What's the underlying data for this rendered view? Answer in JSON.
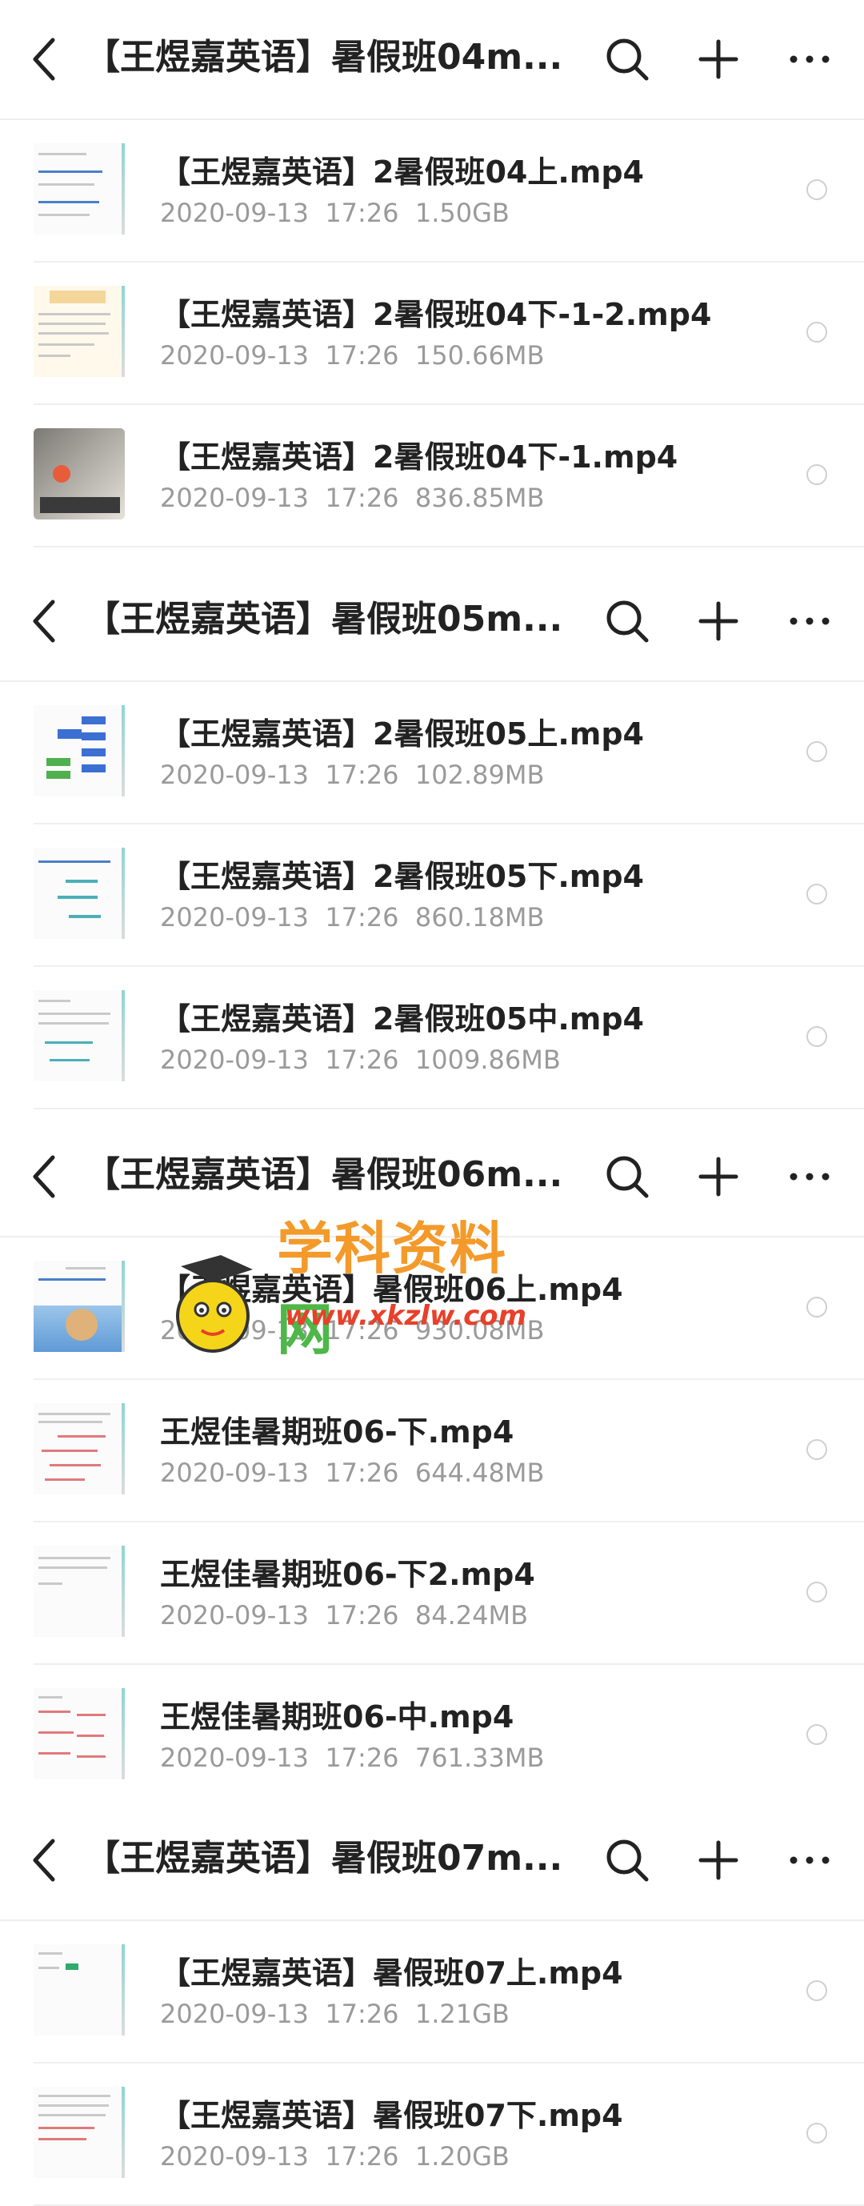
{
  "icons": {
    "back": "chevron-left-icon",
    "search": "search-icon",
    "add": "plus-icon",
    "more": "more-dots-icon"
  },
  "sections": [
    {
      "title": "【王煜嘉英语】暑假班04m...",
      "files": [
        {
          "name": "【王煜嘉英语】2暑假班04上.mp4",
          "meta": "2020-09-13  17:26  1.50GB"
        },
        {
          "name": "【王煜嘉英语】2暑假班04下-1-2.mp4",
          "meta": "2020-09-13  17:26  150.66MB"
        },
        {
          "name": "【王煜嘉英语】2暑假班04下-1.mp4",
          "meta": "2020-09-13  17:26  836.85MB"
        }
      ]
    },
    {
      "title": "【王煜嘉英语】暑假班05m...",
      "files": [
        {
          "name": "【王煜嘉英语】2暑假班05上.mp4",
          "meta": "2020-09-13  17:26  102.89MB"
        },
        {
          "name": "【王煜嘉英语】2暑假班05下.mp4",
          "meta": "2020-09-13  17:26  860.18MB"
        },
        {
          "name": "【王煜嘉英语】2暑假班05中.mp4",
          "meta": "2020-09-13  17:26  1009.86MB"
        }
      ]
    },
    {
      "title": "【王煜嘉英语】暑假班06m...",
      "files": [
        {
          "name": "【王煜嘉英语】暑假班06上.mp4",
          "meta": "2020-09-13  17:26  930.08MB"
        },
        {
          "name": "王煜佳暑期班06-下.mp4",
          "meta": "2020-09-13  17:26  644.48MB"
        },
        {
          "name": "王煜佳暑期班06-下2.mp4",
          "meta": "2020-09-13  17:26  84.24MB"
        },
        {
          "name": "王煜佳暑期班06-中.mp4",
          "meta": "2020-09-13  17:26  761.33MB"
        }
      ]
    },
    {
      "title": "【王煜嘉英语】暑假班07m...",
      "files": [
        {
          "name": "【王煜嘉英语】暑假班07上.mp4",
          "meta": "2020-09-13  17:26  1.21GB"
        },
        {
          "name": "【王煜嘉英语】暑假班07下.mp4",
          "meta": "2020-09-13  17:26  1.20GB"
        }
      ]
    }
  ],
  "watermark": {
    "title_part1": "学科资料",
    "title_part2": "网",
    "url": "www.xkzlw.com"
  }
}
